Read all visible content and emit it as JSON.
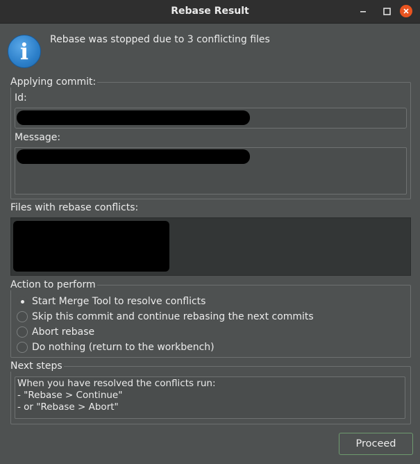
{
  "window": {
    "title": "Rebase Result",
    "controls": {
      "minimize_icon": "minimize-icon",
      "maximize_icon": "maximize-icon",
      "close_icon": "close-icon"
    }
  },
  "message": "Rebase was stopped due to 3 conflicting files",
  "applying_commit": {
    "group_label": "Applying commit:",
    "id_label": "Id:",
    "message_label": "Message:"
  },
  "files_label": "Files with rebase conflicts:",
  "action": {
    "group_label": "Action to perform",
    "options": [
      {
        "label": "Start Merge Tool to resolve conflicts",
        "selected": true
      },
      {
        "label": "Skip this commit and continue rebasing the next commits",
        "selected": false
      },
      {
        "label": "Abort rebase",
        "selected": false
      },
      {
        "label": "Do nothing (return to the workbench)",
        "selected": false
      }
    ]
  },
  "next_steps": {
    "group_label": "Next steps",
    "lines": [
      "When you have resolved the conflicts run:",
      "- \"Rebase > Continue\"",
      "- or \"Rebase > Abort\""
    ]
  },
  "buttons": {
    "proceed": "Proceed"
  },
  "colors": {
    "close_button": "#e95420",
    "info_icon": "#2c7fc9",
    "default_button_border": "#6e9a6e"
  }
}
